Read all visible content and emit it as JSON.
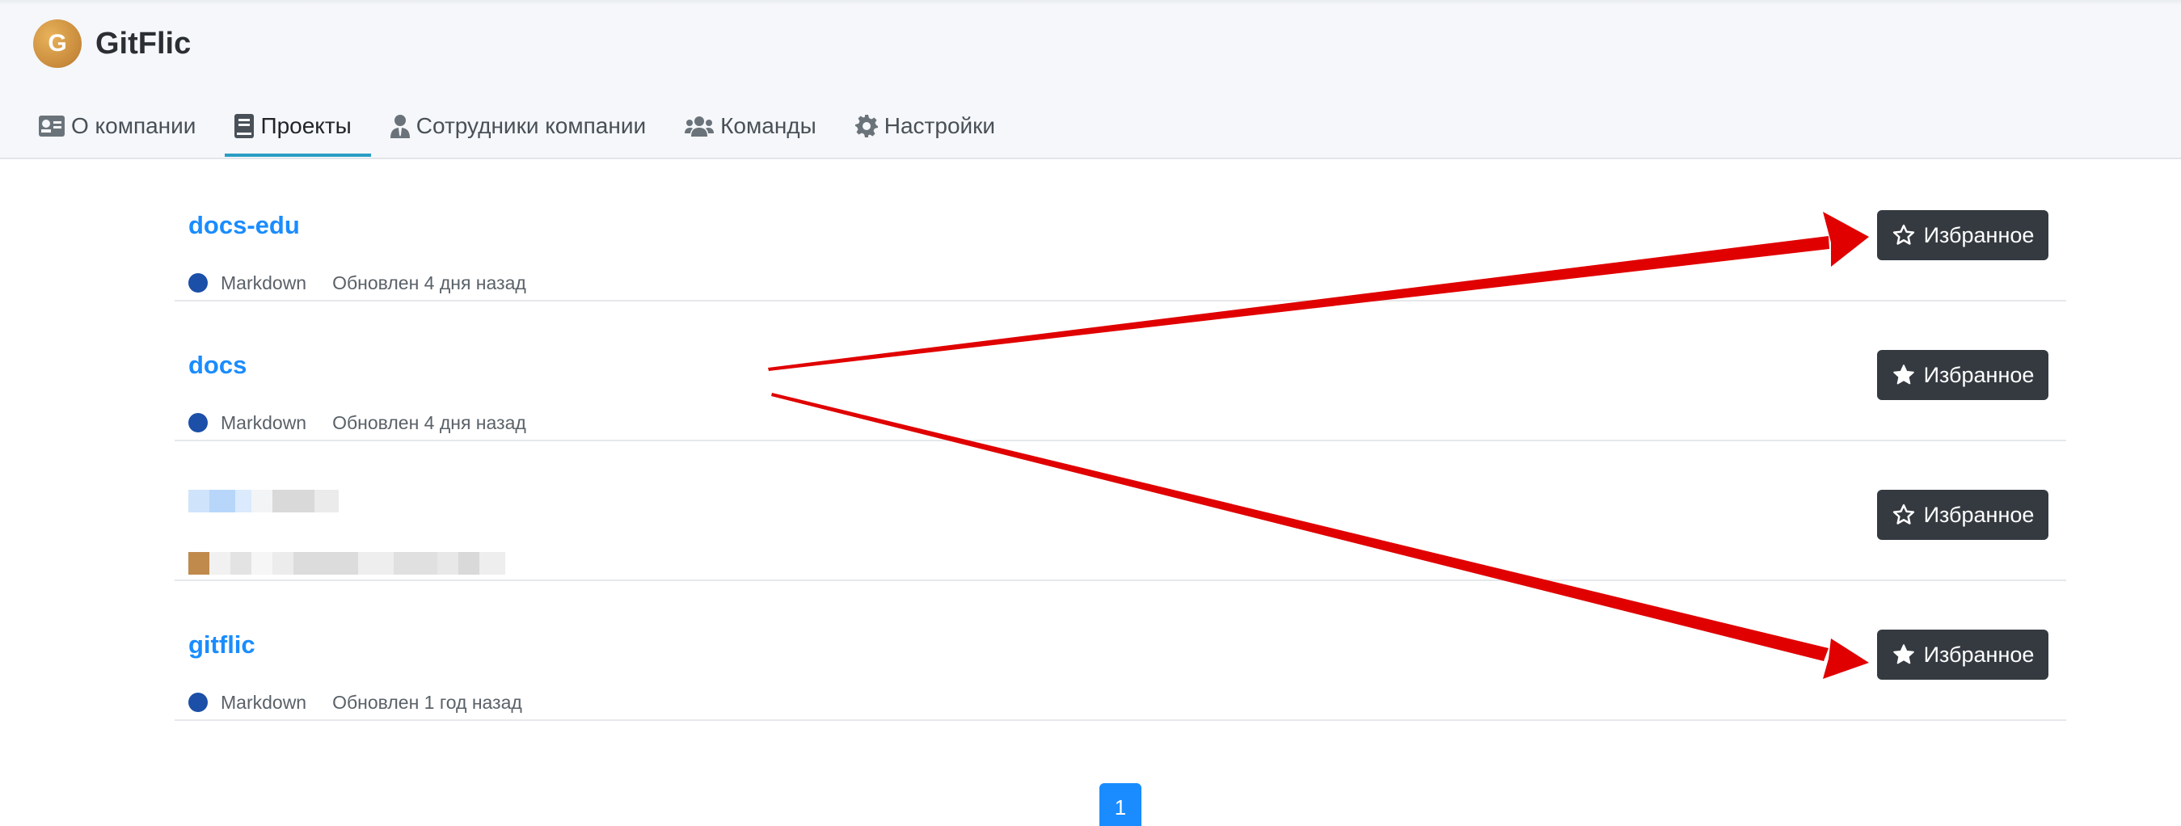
{
  "header": {
    "brand": "GitFlic",
    "logo_letter": "G",
    "tabs": [
      {
        "label": "О компании",
        "icon": "id-card-icon"
      },
      {
        "label": "Проекты",
        "icon": "book-icon",
        "active": true
      },
      {
        "label": "Сотрудники компании",
        "icon": "user-tie-icon"
      },
      {
        "label": "Команды",
        "icon": "users-icon"
      },
      {
        "label": "Настройки",
        "icon": "gear-icon"
      }
    ]
  },
  "projects": [
    {
      "name": "docs-edu",
      "language": "Markdown",
      "updated": "Обновлен 4 дня назад",
      "favorite_label": "Избранное",
      "favorited": false
    },
    {
      "name": "docs",
      "language": "Markdown",
      "updated": "Обновлен 4 дня назад",
      "favorite_label": "Избранное",
      "favorited": true
    },
    {
      "name": "",
      "language": "",
      "updated": "",
      "favorite_label": "Избранное",
      "favorited": false,
      "redacted": true
    },
    {
      "name": "gitflic",
      "language": "Markdown",
      "updated": "Обновлен 1 год назад",
      "favorite_label": "Избранное",
      "favorited": true
    }
  ],
  "pagination": {
    "current_page": "1"
  },
  "colors": {
    "link": "#1a8cff",
    "button_bg": "#343a40",
    "tab_underline": "#2a9cc4",
    "language_dot": "#1b4fa8",
    "annotation_arrow": "#e00000"
  }
}
